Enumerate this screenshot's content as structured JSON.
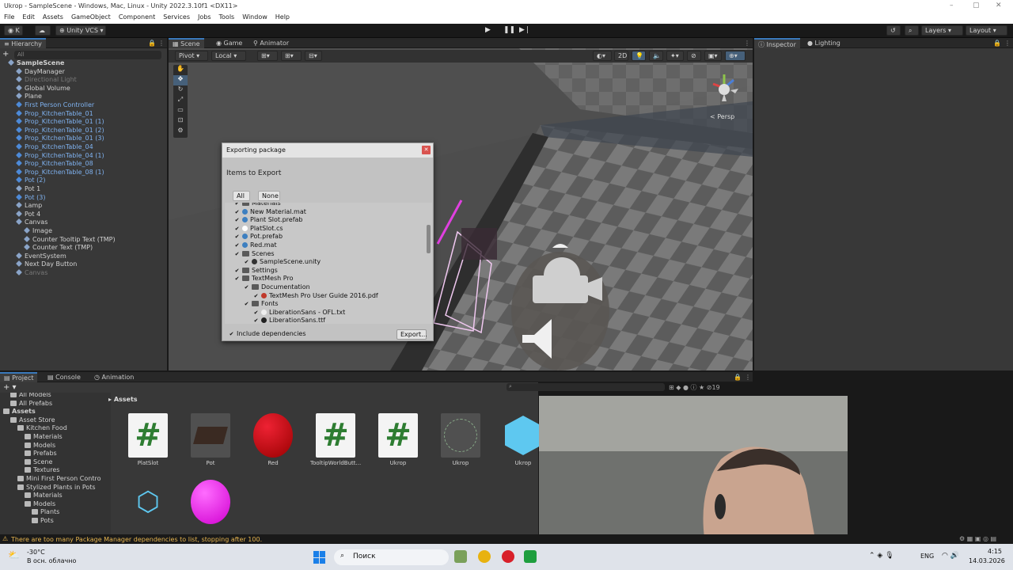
{
  "window": {
    "title": "Ukrop - SampleScene - Windows, Mac, Linux - Unity 2022.3.10f1 <DX11>"
  },
  "menu": [
    "File",
    "Edit",
    "Assets",
    "GameObject",
    "Component",
    "Services",
    "Jobs",
    "Tools",
    "Window",
    "Help"
  ],
  "toolbar": {
    "account": "K",
    "vcs": "Unity VCS",
    "layers": "Layers",
    "layout": "Layout"
  },
  "hierarchy": {
    "tab": "Hierarchy",
    "search_placeholder": "All",
    "items": [
      {
        "label": "SampleScene",
        "indent": 0,
        "style": "bold"
      },
      {
        "label": "DayManager",
        "indent": 1,
        "style": "normal"
      },
      {
        "label": "Directional Light",
        "indent": 1,
        "style": "dim"
      },
      {
        "label": "Global Volume",
        "indent": 1,
        "style": "normal"
      },
      {
        "label": "Plane",
        "indent": 1,
        "style": "normal"
      },
      {
        "label": "First Person Controller",
        "indent": 1,
        "style": "blue"
      },
      {
        "label": "Prop_KitchenTable_01",
        "indent": 1,
        "style": "blue"
      },
      {
        "label": "Prop_KitchenTable_01 (1)",
        "indent": 1,
        "style": "blue"
      },
      {
        "label": "Prop_KitchenTable_01 (2)",
        "indent": 1,
        "style": "blue"
      },
      {
        "label": "Prop_KitchenTable_01 (3)",
        "indent": 1,
        "style": "blue"
      },
      {
        "label": "Prop_KitchenTable_04",
        "indent": 1,
        "style": "blue"
      },
      {
        "label": "Prop_KitchenTable_04 (1)",
        "indent": 1,
        "style": "blue"
      },
      {
        "label": "Prop_KitchenTable_08",
        "indent": 1,
        "style": "blue"
      },
      {
        "label": "Prop_KitchenTable_08 (1)",
        "indent": 1,
        "style": "blue"
      },
      {
        "label": "Pot (2)",
        "indent": 1,
        "style": "blue"
      },
      {
        "label": "Pot 1",
        "indent": 1,
        "style": "normal"
      },
      {
        "label": "Pot (3)",
        "indent": 1,
        "style": "blue"
      },
      {
        "label": "Lamp",
        "indent": 1,
        "style": "normal"
      },
      {
        "label": "Pot 4",
        "indent": 1,
        "style": "normal"
      },
      {
        "label": "Canvas",
        "indent": 1,
        "style": "normal"
      },
      {
        "label": "Image",
        "indent": 2,
        "style": "normal"
      },
      {
        "label": "Counter  Tooltip Text (TMP)",
        "indent": 2,
        "style": "normal"
      },
      {
        "label": "Counter Text (TMP)",
        "indent": 2,
        "style": "normal"
      },
      {
        "label": "EventSystem",
        "indent": 1,
        "style": "normal"
      },
      {
        "label": "Next Day Button",
        "indent": 1,
        "style": "normal"
      },
      {
        "label": "Canvas",
        "indent": 1,
        "style": "dim"
      }
    ]
  },
  "scene": {
    "tabs": [
      "Scene",
      "Game",
      "Animator"
    ],
    "pivot": "Pivot",
    "local": "Local",
    "mode2d": "2D",
    "persp": "< Persp"
  },
  "inspector": {
    "tabs": [
      "Inspector",
      "Lighting"
    ]
  },
  "dialog": {
    "title": "Exporting package",
    "heading": "Items to Export",
    "all": "All",
    "none": "None",
    "items": [
      {
        "label": "Materials",
        "indent": 0,
        "type": "folder"
      },
      {
        "label": "New Material.mat",
        "indent": 0,
        "type": "mat"
      },
      {
        "label": "Plant Slot.prefab",
        "indent": 0,
        "type": "prefab"
      },
      {
        "label": "PlatSlot.cs",
        "indent": 0,
        "type": "cs"
      },
      {
        "label": "Pot.prefab",
        "indent": 0,
        "type": "prefab"
      },
      {
        "label": "Red.mat",
        "indent": 0,
        "type": "mat"
      },
      {
        "label": "Scenes",
        "indent": 0,
        "type": "folder"
      },
      {
        "label": "SampleScene.unity",
        "indent": 1,
        "type": "unity"
      },
      {
        "label": "Settings",
        "indent": 0,
        "type": "folder"
      },
      {
        "label": "TextMesh Pro",
        "indent": 0,
        "type": "folder"
      },
      {
        "label": "Documentation",
        "indent": 1,
        "type": "folder"
      },
      {
        "label": "TextMesh Pro User Guide 2016.pdf",
        "indent": 2,
        "type": "pdf"
      },
      {
        "label": "Fonts",
        "indent": 1,
        "type": "folder"
      },
      {
        "label": "LiberationSans - OFL.txt",
        "indent": 2,
        "type": "txt"
      },
      {
        "label": "LiberationSans.ttf",
        "indent": 2,
        "type": "font"
      }
    ],
    "include_dependencies": "Include dependencies",
    "export_button": "Export..."
  },
  "project": {
    "tabs": [
      "Project",
      "Console",
      "Animation"
    ],
    "breadcrumb": "Assets",
    "asset_count": "19",
    "tree": [
      {
        "label": "All Models",
        "indent": 1
      },
      {
        "label": "All Prefabs",
        "indent": 1
      },
      {
        "label": "Assets",
        "indent": 0,
        "bold": true
      },
      {
        "label": "Asset Store",
        "indent": 1
      },
      {
        "label": "Kitchen Food",
        "indent": 2
      },
      {
        "label": "Materials",
        "indent": 3
      },
      {
        "label": "Models",
        "indent": 3
      },
      {
        "label": "Prefabs",
        "indent": 3
      },
      {
        "label": "Scene",
        "indent": 3
      },
      {
        "label": "Textures",
        "indent": 3
      },
      {
        "label": "Mini First Person Contro",
        "indent": 2
      },
      {
        "label": "Stylized Plants in Pots",
        "indent": 2
      },
      {
        "label": "Materials",
        "indent": 3
      },
      {
        "label": "Models",
        "indent": 3
      },
      {
        "label": "Plants",
        "indent": 4
      },
      {
        "label": "Pots",
        "indent": 4
      }
    ],
    "assets": [
      {
        "label": "PlatSlot",
        "kind": "script"
      },
      {
        "label": "Pot",
        "kind": "pot"
      },
      {
        "label": "Red",
        "kind": "red"
      },
      {
        "label": "TooltipWorldButt...",
        "kind": "script"
      },
      {
        "label": "Ukrop",
        "kind": "script"
      },
      {
        "label": "Ukrop",
        "kind": "ukrop"
      },
      {
        "label": "Ukrop",
        "kind": "cube"
      },
      {
        "label": "",
        "kind": "prefabvariant"
      },
      {
        "label": "",
        "kind": "magenta"
      }
    ]
  },
  "status": {
    "message": "There are too many Package Manager dependencies to list, stopping after 100."
  },
  "taskbar": {
    "weather_temp": "-30°C",
    "weather_desc": "В осн. облачно",
    "search": "Поиск",
    "lang": "ENG",
    "time": "4:15",
    "date": "14.03.2026"
  }
}
